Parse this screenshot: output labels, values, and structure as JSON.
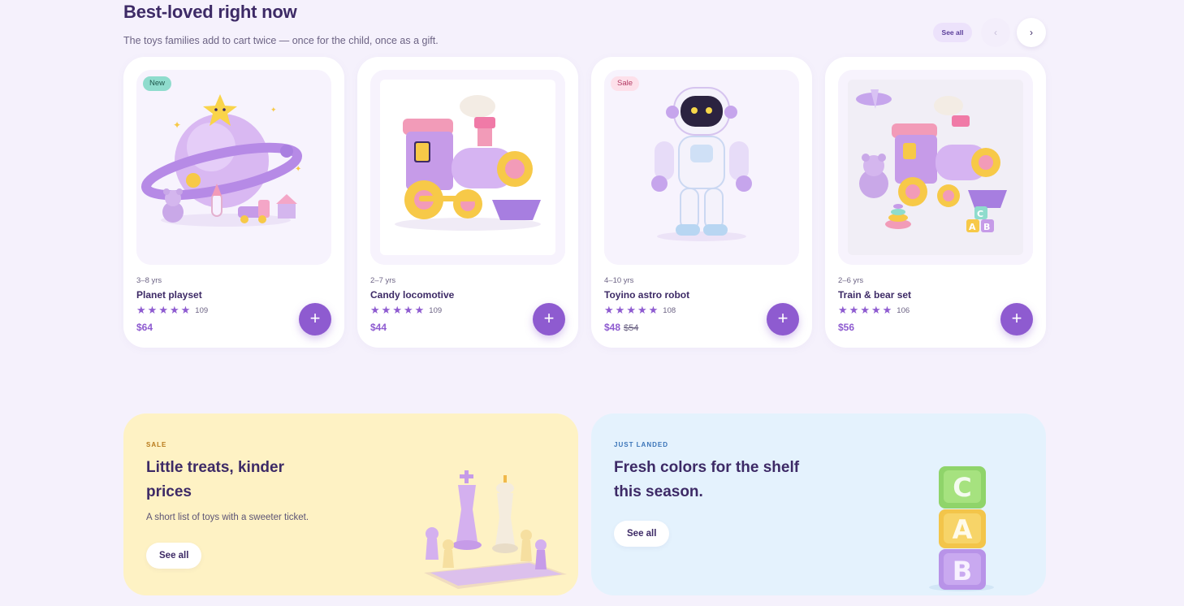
{
  "section": {
    "title": "Best-loved right now",
    "subtitle": "The toys families add to cart twice — once for the child, once as a gift.",
    "see_all": "See all",
    "prev": "‹",
    "next": "›"
  },
  "products": [
    {
      "badge": "New",
      "age": "3–8 yrs",
      "name": "Planet playset",
      "rating": 5,
      "reviews": "109",
      "price": "$64",
      "old_price": ""
    },
    {
      "badge": "",
      "age": "2–7 yrs",
      "name": "Candy locomotive",
      "rating": 5,
      "reviews": "109",
      "price": "$44",
      "old_price": ""
    },
    {
      "badge": "Sale",
      "age": "4–10 yrs",
      "name": "Toyino astro robot",
      "rating": 5,
      "reviews": "108",
      "price": "$48",
      "old_price": "$54"
    },
    {
      "badge": "",
      "age": "2–6 yrs",
      "name": "Train & bear set",
      "rating": 5,
      "reviews": "106",
      "price": "$56",
      "old_price": ""
    }
  ],
  "add_symbol": "+",
  "star_symbol": "★",
  "promos": [
    {
      "eyebrow": "SALE",
      "title": "Little treats, kinder prices",
      "text": "A short list of toys with a sweeter ticket.",
      "button": "See all"
    },
    {
      "eyebrow": "JUST LANDED",
      "title": "Fresh colors for the shelf this season.",
      "text": "",
      "button": "See all"
    }
  ],
  "blocks": [
    "C",
    "A",
    "B"
  ],
  "colors": {
    "accent": "#8e5bd0",
    "heading": "#3d2a66",
    "page_bg": "#f5f1fc",
    "promo_yellow": "#fef2c4",
    "promo_blue": "#e4f2fd"
  }
}
